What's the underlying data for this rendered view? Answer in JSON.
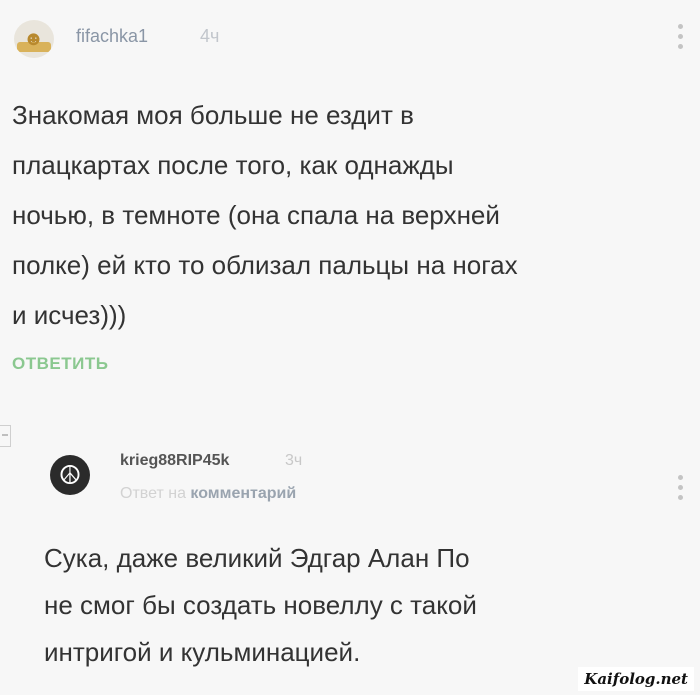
{
  "comment1": {
    "username": "fifachka1",
    "time": "4ч",
    "text_lines": [
      "Знакомая моя больше не ездит в",
      "плацкартах после того, как однажды",
      "ночью, в темноте (она спала на верхней",
      "полке) ей кто то облизал пальцы на ногах",
      "и исчез)))"
    ],
    "reply_label": "ОТВЕТИТЬ",
    "avatar_icon": "cartoon-avatar-icon"
  },
  "comment2": {
    "username": "krieg88RIP45k",
    "time": "3ч",
    "reply_to_prefix": "Ответ на",
    "reply_to_target": "комментарий",
    "text_lines": [
      "Сука, даже великий Эдгар Алан По",
      "не смог бы создать новеллу с такой",
      "интригой и кульминацией."
    ],
    "avatar_icon": "peace-symbol-icon"
  },
  "watermark": "Kaifolog.net",
  "colors": {
    "background": "#f7f7f7",
    "username": "#8a96a6",
    "reply_accent": "#8bc890",
    "body_text": "#333333"
  }
}
